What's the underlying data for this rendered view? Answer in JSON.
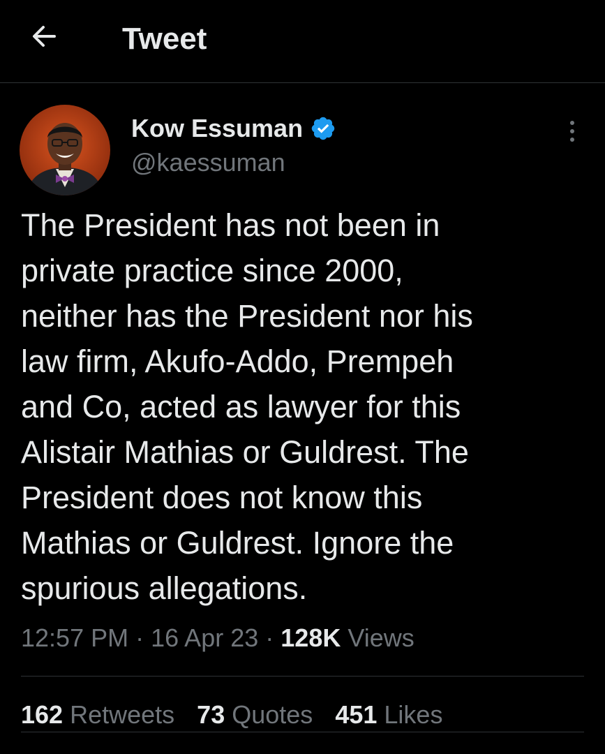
{
  "header": {
    "title": "Tweet",
    "back_icon": "arrow-left-icon"
  },
  "author": {
    "display_name": "Kow Essuman",
    "handle": "@kaessuman",
    "verified_icon": "verified-badge-icon",
    "verified_color": "#1d9bf0"
  },
  "tweet": {
    "text": "The President has not been in\nprivate practice since 2000,\nneither has the President nor his\nlaw firm, Akufo-Addo, Prempeh\nand Co, acted as lawyer for this\nAlistair Mathias or Guldrest. The\nPresident does not know this\nMathias or Guldrest. Ignore the\nspurious allegations.",
    "time": "12:57 PM",
    "date": "16 Apr 23",
    "separator": "·",
    "views_count": "128K",
    "views_label": "Views"
  },
  "stats": {
    "retweets_count": "162",
    "retweets_label": "Retweets",
    "quotes_count": "73",
    "quotes_label": "Quotes",
    "likes_count": "451",
    "likes_label": "Likes"
  },
  "colors": {
    "background": "#000000",
    "text_primary": "#e7e9ea",
    "text_secondary": "#71767b",
    "divider": "#2f3336",
    "accent": "#1d9bf0"
  }
}
